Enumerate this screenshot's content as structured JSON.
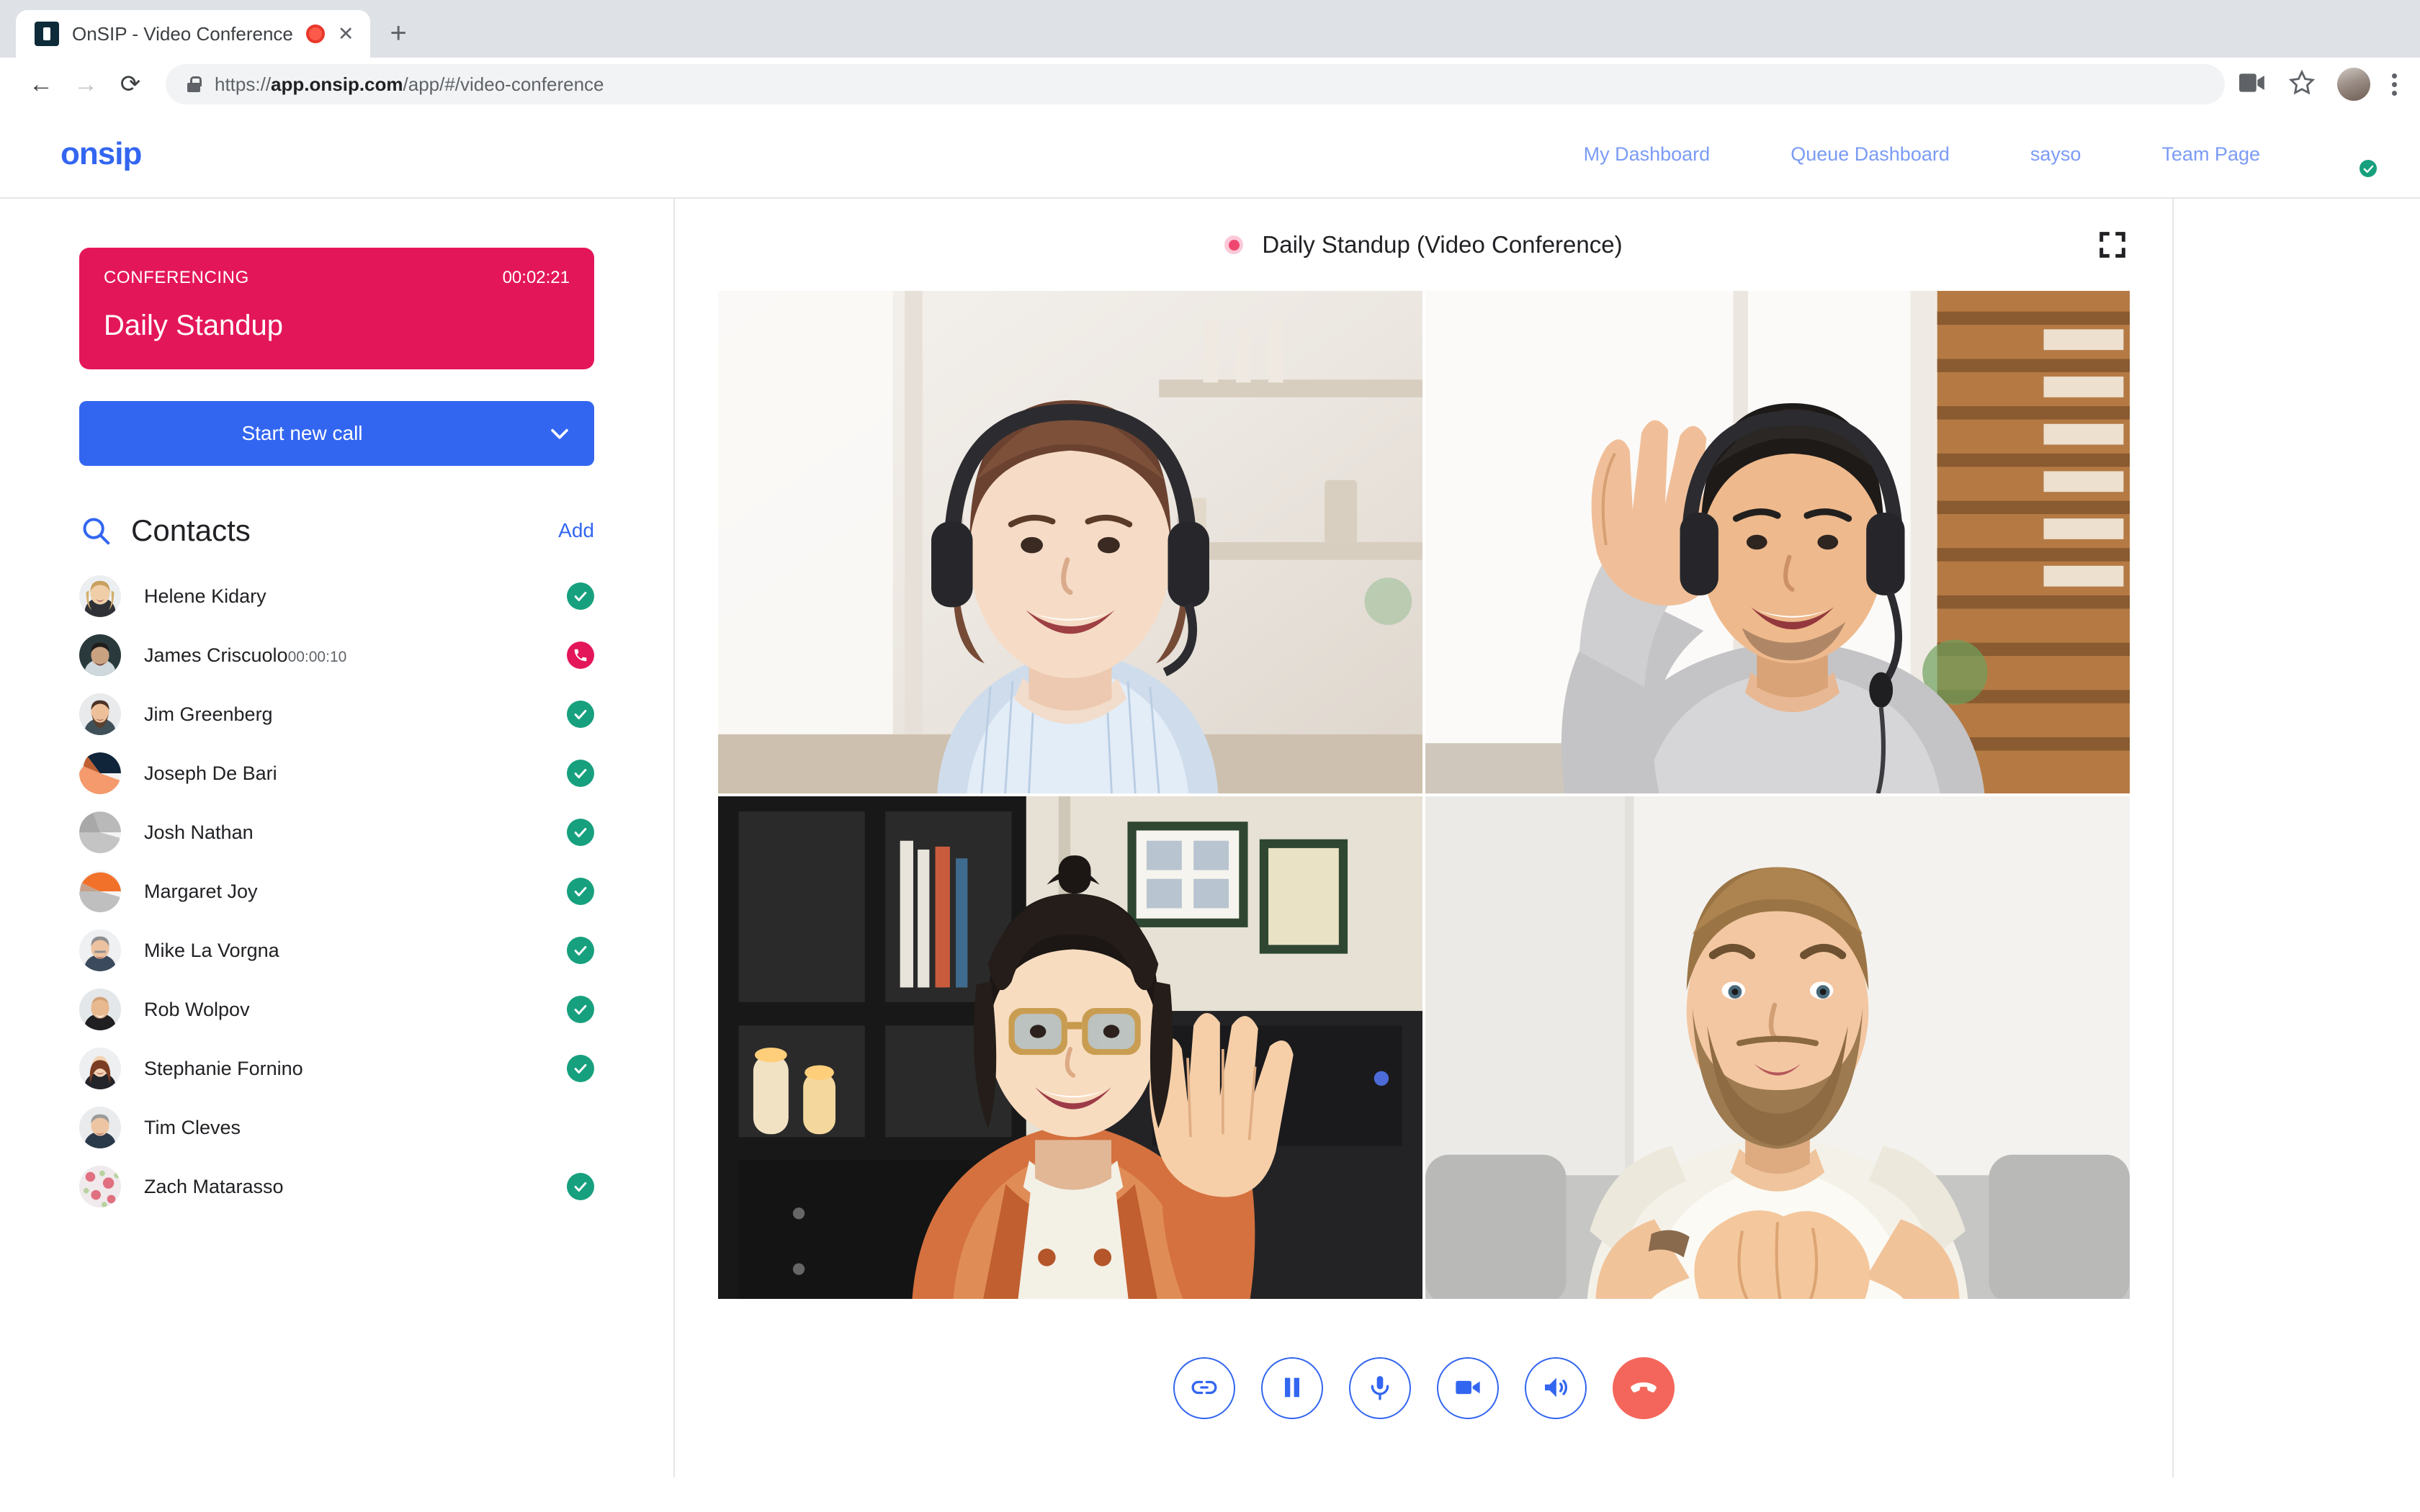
{
  "browser": {
    "tab": {
      "title": "OnSIP - Video Conference",
      "favicon_icon": "onsip-favicon-icon",
      "recording_icon": "recording-indicator-icon",
      "close_label": "✕"
    },
    "new_tab_label": "+",
    "back_label": "←",
    "forward_label": "→",
    "reload_label": "⟳",
    "url_prefix": "https://",
    "url_domain": "app.onsip.com",
    "url_path": "/app/#/video-conference",
    "lock_icon": "lock-icon",
    "camera_icon": "camera-permission-icon",
    "bookmark_icon": "star-icon",
    "profile_icon": "browser-profile-avatar",
    "menu_icon": "kebab-menu-icon"
  },
  "header": {
    "logo_text": "onsip",
    "nav": [
      {
        "label": "My Dashboard"
      },
      {
        "label": "Queue Dashboard"
      },
      {
        "label": "sayso"
      },
      {
        "label": "Team Page"
      }
    ],
    "avatar_icon": "user-avatar",
    "presence_icon": "available-check-icon"
  },
  "sidebar": {
    "conference_card": {
      "status_label": "CONFERENCING",
      "timer": "00:02:21",
      "title": "Daily Standup"
    },
    "start_call": {
      "label": "Start new call",
      "caret_icon": "chevron-down-icon"
    },
    "contacts": {
      "search_icon": "search-icon",
      "title": "Contacts",
      "add_label": "Add",
      "items": [
        {
          "name": "Helene Kidary",
          "sub": "",
          "status": "available",
          "avatar": "photo-helene"
        },
        {
          "name": "James Criscuolo",
          "sub": "00:00:10",
          "status": "oncall",
          "avatar": "photo-james"
        },
        {
          "name": "Jim Greenberg",
          "sub": "",
          "status": "available",
          "avatar": "photo-jim"
        },
        {
          "name": "Joseph De Bari",
          "sub": "",
          "status": "available",
          "avatar": "placeholder-navy-orange"
        },
        {
          "name": "Josh Nathan",
          "sub": "",
          "status": "available",
          "avatar": "placeholder-gray"
        },
        {
          "name": "Margaret Joy",
          "sub": "",
          "status": "available",
          "avatar": "placeholder-orange"
        },
        {
          "name": "Mike La Vorgna",
          "sub": "",
          "status": "available",
          "avatar": "photo-mike"
        },
        {
          "name": "Rob Wolpov",
          "sub": "",
          "status": "available",
          "avatar": "photo-rob"
        },
        {
          "name": "Stephanie Fornino",
          "sub": "",
          "status": "available",
          "avatar": "photo-stephanie"
        },
        {
          "name": "Tim Cleves",
          "sub": "",
          "status": "none",
          "avatar": "photo-tim"
        },
        {
          "name": "Zach Matarasso",
          "sub": "",
          "status": "available",
          "avatar": "photo-zach"
        }
      ]
    }
  },
  "conference": {
    "recording_icon": "recording-dot-icon",
    "title": "Daily Standup (Video Conference)",
    "fullscreen_icon": "fullscreen-icon",
    "participants": [
      {
        "name": "participant-top-left",
        "description": "Woman with headset smiling"
      },
      {
        "name": "participant-top-right",
        "description": "Man with headset waving"
      },
      {
        "name": "participant-bottom-left",
        "description": "Woman with glasses waving"
      },
      {
        "name": "participant-bottom-right",
        "description": "Bearded man in white shirt"
      }
    ],
    "controls": [
      {
        "name": "transfer-link-button",
        "icon": "link-icon"
      },
      {
        "name": "hold-button",
        "icon": "pause-icon"
      },
      {
        "name": "mute-button",
        "icon": "microphone-icon"
      },
      {
        "name": "video-button",
        "icon": "video-camera-icon"
      },
      {
        "name": "speaker-button",
        "icon": "speaker-icon"
      },
      {
        "name": "end-call-button",
        "icon": "hang-up-icon"
      }
    ]
  },
  "colors": {
    "brand_blue": "#3366f0",
    "accent_pink": "#e4165a",
    "status_green": "#17a07e",
    "end_call_red": "#f4665b",
    "nav_link_blue": "#7b9bf5"
  }
}
